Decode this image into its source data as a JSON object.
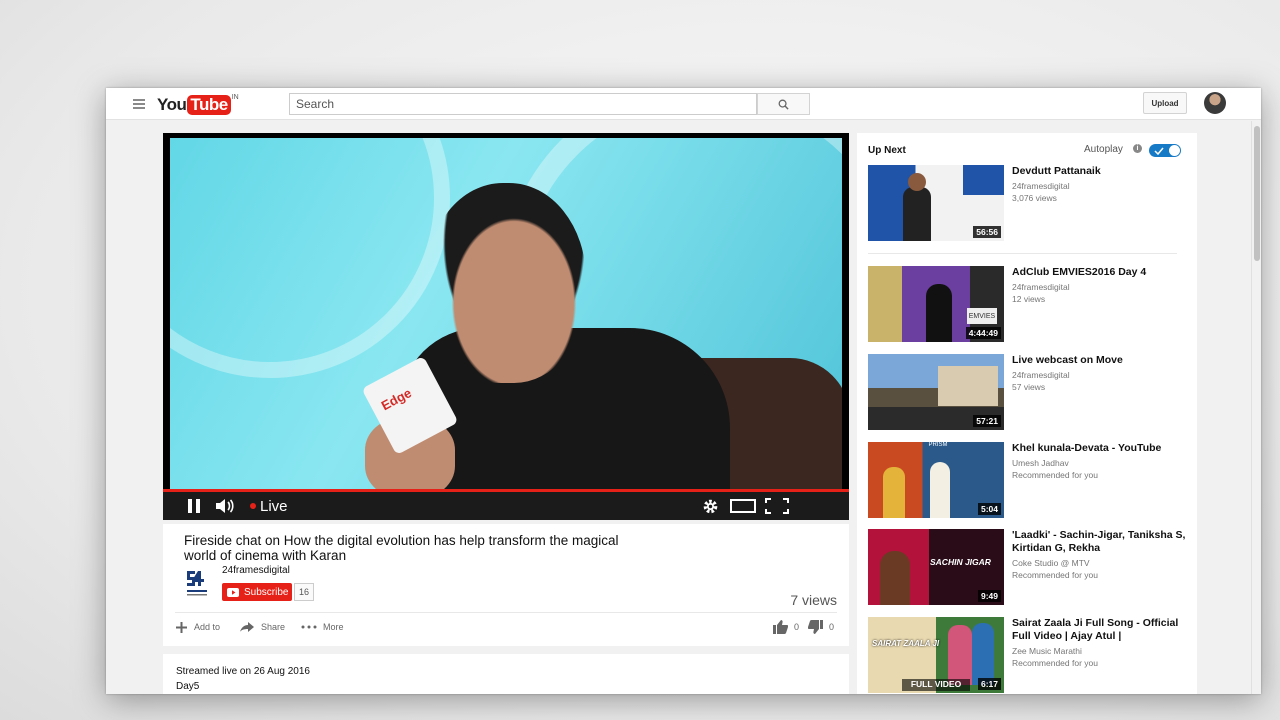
{
  "header": {
    "logo_you": "You",
    "logo_tube": "Tube",
    "logo_country": "IN",
    "search_placeholder": "Search",
    "upload_label": "Upload"
  },
  "player": {
    "live_label": "Live",
    "mic_brand": "Edge"
  },
  "video": {
    "title": "Fireside chat on How the digital evolution has help transform the magical world of cinema with Karan",
    "channel_name": "24framesdigital",
    "subscribe_label": "Subscribe",
    "subscriber_count": "16",
    "views": "7 views",
    "actions": {
      "add_to": "Add to",
      "share": "Share",
      "more": "More",
      "likes": "0",
      "dislikes": "0"
    }
  },
  "description": {
    "streamed": "Streamed live on 26 Aug 2016",
    "text": "Day5"
  },
  "upnext": {
    "title": "Up Next",
    "autoplay_label": "Autoplay",
    "autoplay_on": true,
    "items": [
      {
        "title": "Devdutt Pattanaik",
        "channel": "24framesdigital",
        "meta": "3,076 views",
        "duration": "56:56",
        "thumb_colors": [
          "#1f54a8",
          "#f2f2f2"
        ],
        "thumb_text": ""
      },
      {
        "title": "AdClub EMVIES2016 Day 4",
        "channel": "24framesdigital",
        "meta": "12 views",
        "duration": "4:44:49",
        "thumb_colors": [
          "#6b3fa0",
          "#c9b36a"
        ],
        "thumb_text": "EMVIES"
      },
      {
        "title": "Live webcast on Move",
        "channel": "24framesdigital",
        "meta": "57 views",
        "duration": "57:21",
        "thumb_colors": [
          "#7aa6d8",
          "#5a5040"
        ],
        "thumb_text": ""
      },
      {
        "title": "Khel kunala-Devata - YouTube",
        "channel": "Umesh Jadhav",
        "meta": "Recommended for you",
        "duration": "5:04",
        "thumb_colors": [
          "#c94a20",
          "#2b5a8a"
        ],
        "thumb_text": "PRISM"
      },
      {
        "title": "'Laadki' - Sachin-Jigar, Taniksha S, Kirtidan G, Rekha",
        "channel": "Coke Studio @ MTV",
        "meta": "Recommended for you",
        "duration": "9:49",
        "thumb_colors": [
          "#b3123a",
          "#2a0c18"
        ],
        "thumb_text": "SACHIN JIGAR"
      },
      {
        "title": "Sairat Zaala Ji Full Song - Official Full Video | Ajay Atul |",
        "channel": "Zee Music Marathi",
        "meta": "Recommended for you",
        "duration": "6:17",
        "thumb_colors": [
          "#e8d9b0",
          "#3e7a3a"
        ],
        "thumb_text": "SAIRAT ZAALA JI"
      }
    ],
    "thumb_caption_last": "FULL VIDEO"
  },
  "colors": {
    "brand_red": "#e62117",
    "toggle_blue": "#167ac6"
  }
}
